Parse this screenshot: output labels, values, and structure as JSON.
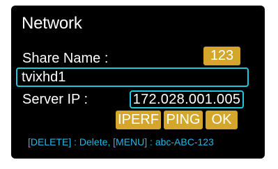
{
  "network_dialog": {
    "title": "Network",
    "share_name_label": "Share Name :",
    "keyboard_mode_button": "123",
    "share_name_value": "tvixhd1",
    "server_ip_label": "Server IP :",
    "server_ip_value": "172.028.001.005",
    "buttons": {
      "iperf": "IPERF",
      "ping": "PING",
      "ok": "OK"
    },
    "hint": "[DELETE] : Delete, [MENU] : abc-ABC-123"
  },
  "colors": {
    "panel_background": "#000000",
    "field_border": "#23c6dc",
    "button_fill": "#d4a72c",
    "hint_text": "#23b8e8",
    "text": "#ffffff"
  }
}
